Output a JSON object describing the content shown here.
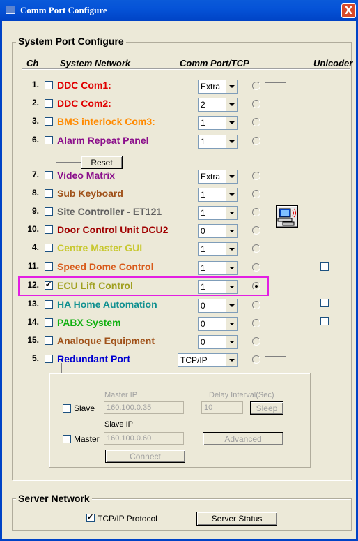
{
  "window": {
    "title": "Comm Port Configure",
    "close_glyph": "X"
  },
  "system_group": {
    "title": "System Port Configure"
  },
  "headers": {
    "ch": "Ch",
    "system_network": "System Network",
    "comm_port": "Comm Port/TCP",
    "unicoder": "Unicoder"
  },
  "reset_label": "Reset",
  "rows": [
    {
      "num": "1.",
      "label": "DDC Com1:",
      "color": "#e00000",
      "port": "Extra",
      "checked": false
    },
    {
      "num": "2.",
      "label": "DDC Com2:",
      "color": "#e00000",
      "port": "2",
      "checked": false
    },
    {
      "num": "3.",
      "label": "BMS interlock Com3:",
      "color": "#ff8a00",
      "port": "1",
      "checked": false
    },
    {
      "num": "6.",
      "label": "Alarm Repeat Panel",
      "color": "#8b0f8b",
      "port": "1",
      "checked": false
    },
    {
      "num": "7.",
      "label": "Video Matrix",
      "color": "#8b0f8b",
      "port": "Extra",
      "checked": false
    },
    {
      "num": "8.",
      "label": "Sub Keyboard",
      "color": "#a0521a",
      "port": "1",
      "checked": false
    },
    {
      "num": "9.",
      "label": "Site Controller - ET121",
      "color": "#606060",
      "port": "1",
      "checked": false
    },
    {
      "num": "10.",
      "label": "Door Control Unit DCU2",
      "color": "#a00000",
      "port": "0",
      "checked": false
    },
    {
      "num": "4.",
      "label": "Centre Master GUI",
      "color": "#c8c830",
      "port": "1",
      "checked": false
    },
    {
      "num": "11.",
      "label": "Speed Dome Control",
      "color": "#d85a1a",
      "port": "1",
      "checked": false
    },
    {
      "num": "12.",
      "label": "ECU Lift Control",
      "color": "#a0a020",
      "port": "1",
      "checked": true
    },
    {
      "num": "13.",
      "label": "HA Home Automation",
      "color": "#109090",
      "port": "0",
      "checked": false
    },
    {
      "num": "14.",
      "label": "PABX System",
      "color": "#10b010",
      "port": "0",
      "checked": false
    },
    {
      "num": "15.",
      "label": "Analoque Equipment",
      "color": "#a0521a",
      "port": "0",
      "checked": false
    },
    {
      "num": "5.",
      "label": "Redundant Port",
      "color": "#0000d0",
      "port": "TCP/IP",
      "checked": false
    }
  ],
  "redundant": {
    "master_ip_label": "Master IP",
    "delay_label": "Delay Interval(Sec)",
    "slave_label": "Slave",
    "master_ip_value": "160.100.0.35",
    "delay_value": "10",
    "sleep_label": "Sleep",
    "slave_ip_label": "Slave IP",
    "master_label": "Master",
    "slave_ip_value": "160.100.0.60",
    "advanced_label": "Advanced",
    "connect_label": "Connect"
  },
  "server_group": {
    "title": "Server Network",
    "tcpip_label": "TCP/IP Protocol",
    "tcpip_checked": true,
    "server_status_label": "Server Status"
  }
}
